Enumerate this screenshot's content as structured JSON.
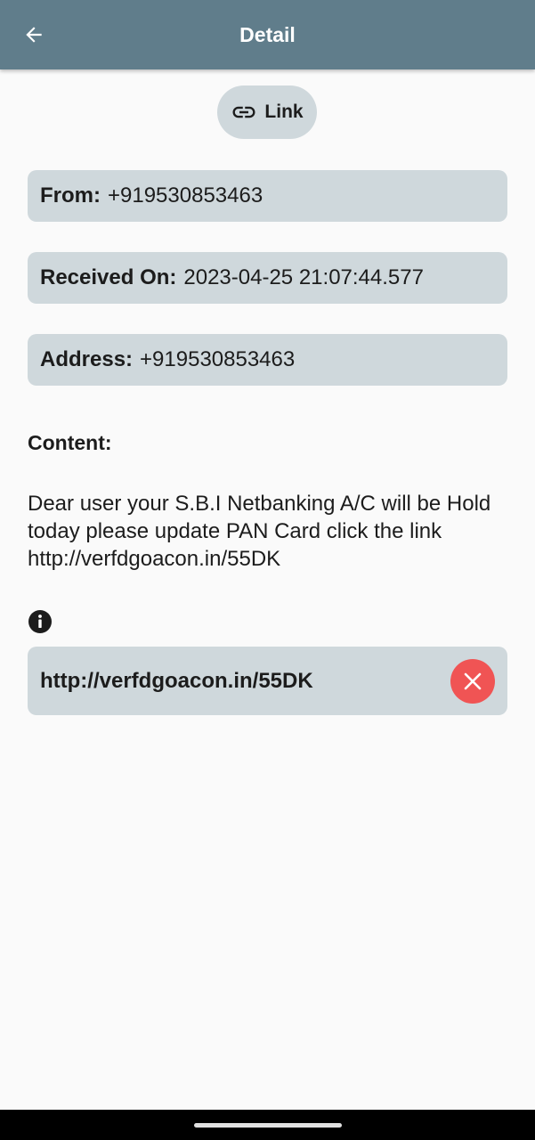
{
  "appbar": {
    "title": "Detail",
    "back_icon": "arrow-left-icon"
  },
  "link_chip": {
    "label": "Link",
    "icon": "link-icon"
  },
  "fields": {
    "from": {
      "label": "From:",
      "value": "+919530853463"
    },
    "received": {
      "label": "Received On:",
      "value": "2023-04-25 21:07:44.577"
    },
    "address": {
      "label": "Address:",
      "value": "+919530853463"
    }
  },
  "content": {
    "label": "Content:",
    "text": "Dear user your S.B.I Netbanking A/C will be Hold today please update PAN Card click the link http://verfdgoacon.in/55DK"
  },
  "info_icon": "info-icon",
  "url_card": {
    "url": "http://verfdgoacon.in/55DK",
    "close_icon": "close-icon"
  },
  "colors": {
    "appbar": "#607d8b",
    "card": "#cfd8dc",
    "background": "#fafafa",
    "danger": "#f05454"
  }
}
